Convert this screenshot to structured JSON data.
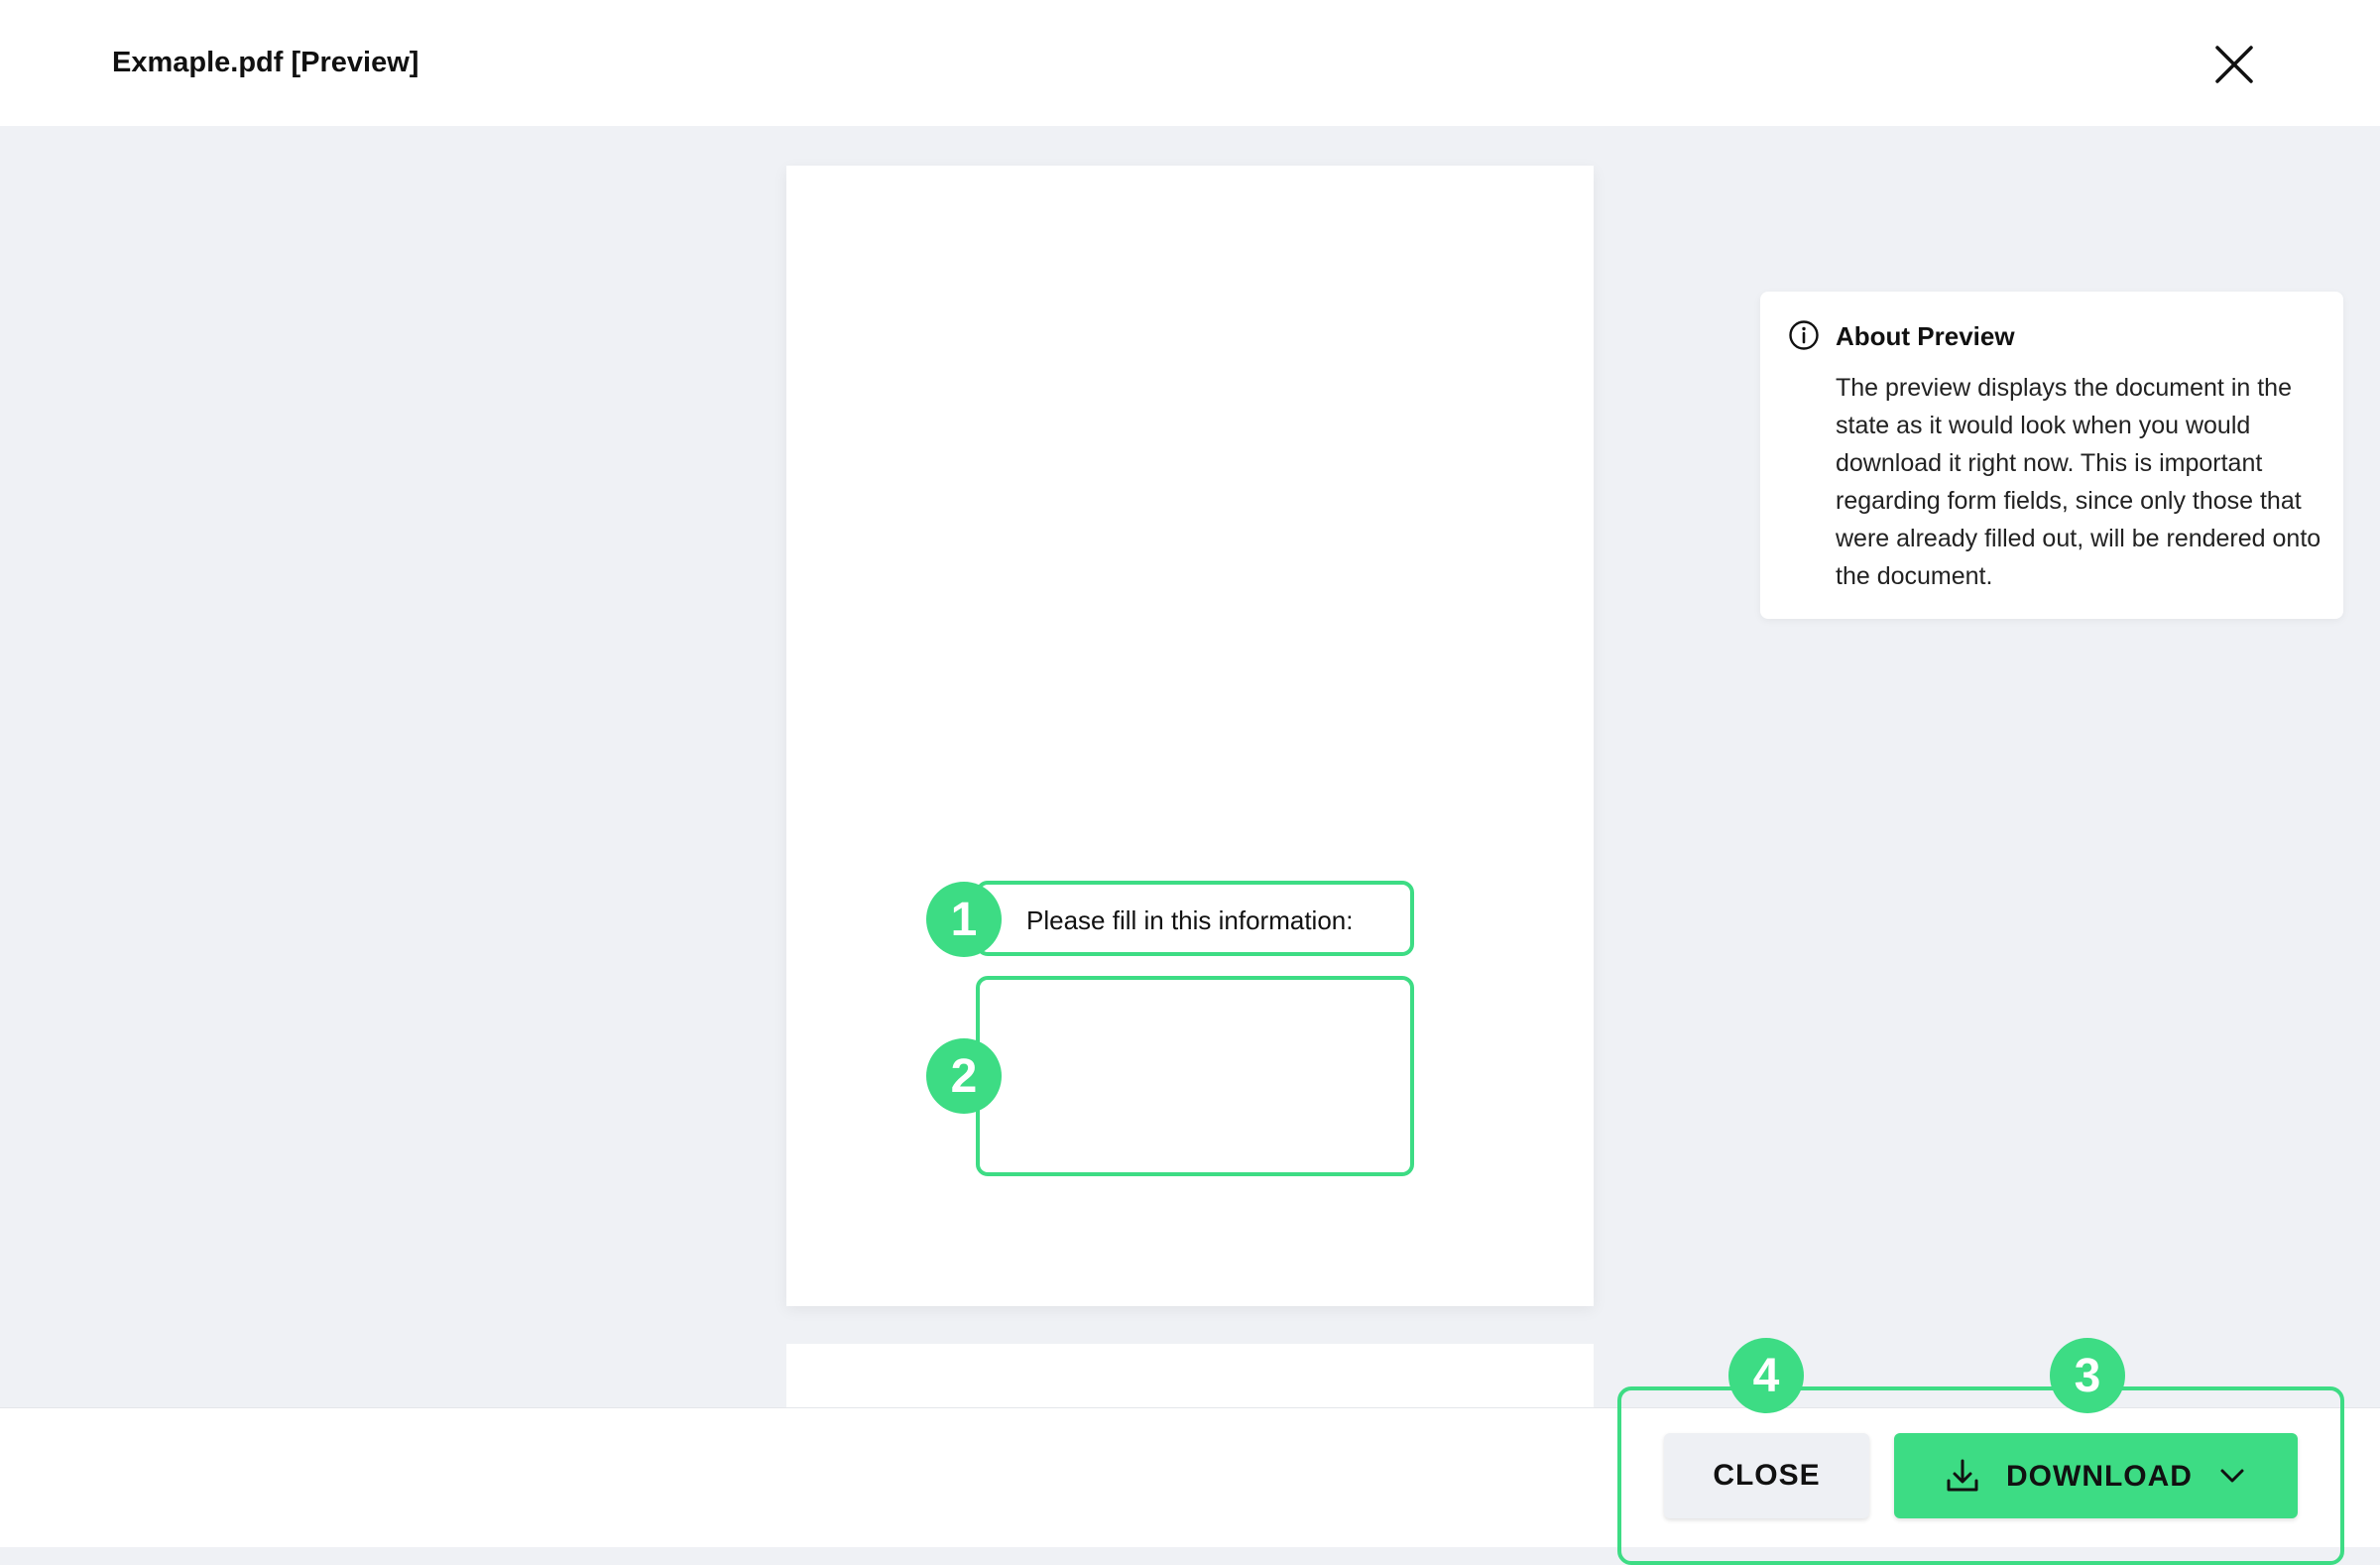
{
  "header": {
    "title": "Exmaple.pdf [Preview]",
    "close_icon": "close-icon"
  },
  "document": {
    "field_label": "Please fill in this information:",
    "field_value": ""
  },
  "markers": [
    "1",
    "2",
    "3",
    "4"
  ],
  "info": {
    "icon": "info-icon",
    "title": "About Preview",
    "body": "The preview displays the document in the state as it would look when you would download it right now. This is important regarding form fields, since only those that were already filled out, will be rendered onto the document."
  },
  "footer": {
    "close_label": "CLOSE",
    "download_label": "DOWNLOAD",
    "download_icon": "download-icon",
    "dropdown_icon": "chevron-down-icon"
  },
  "colors": {
    "accent": "#3ddc84",
    "background": "#eff1f5",
    "button_secondary": "#eef0f4"
  }
}
